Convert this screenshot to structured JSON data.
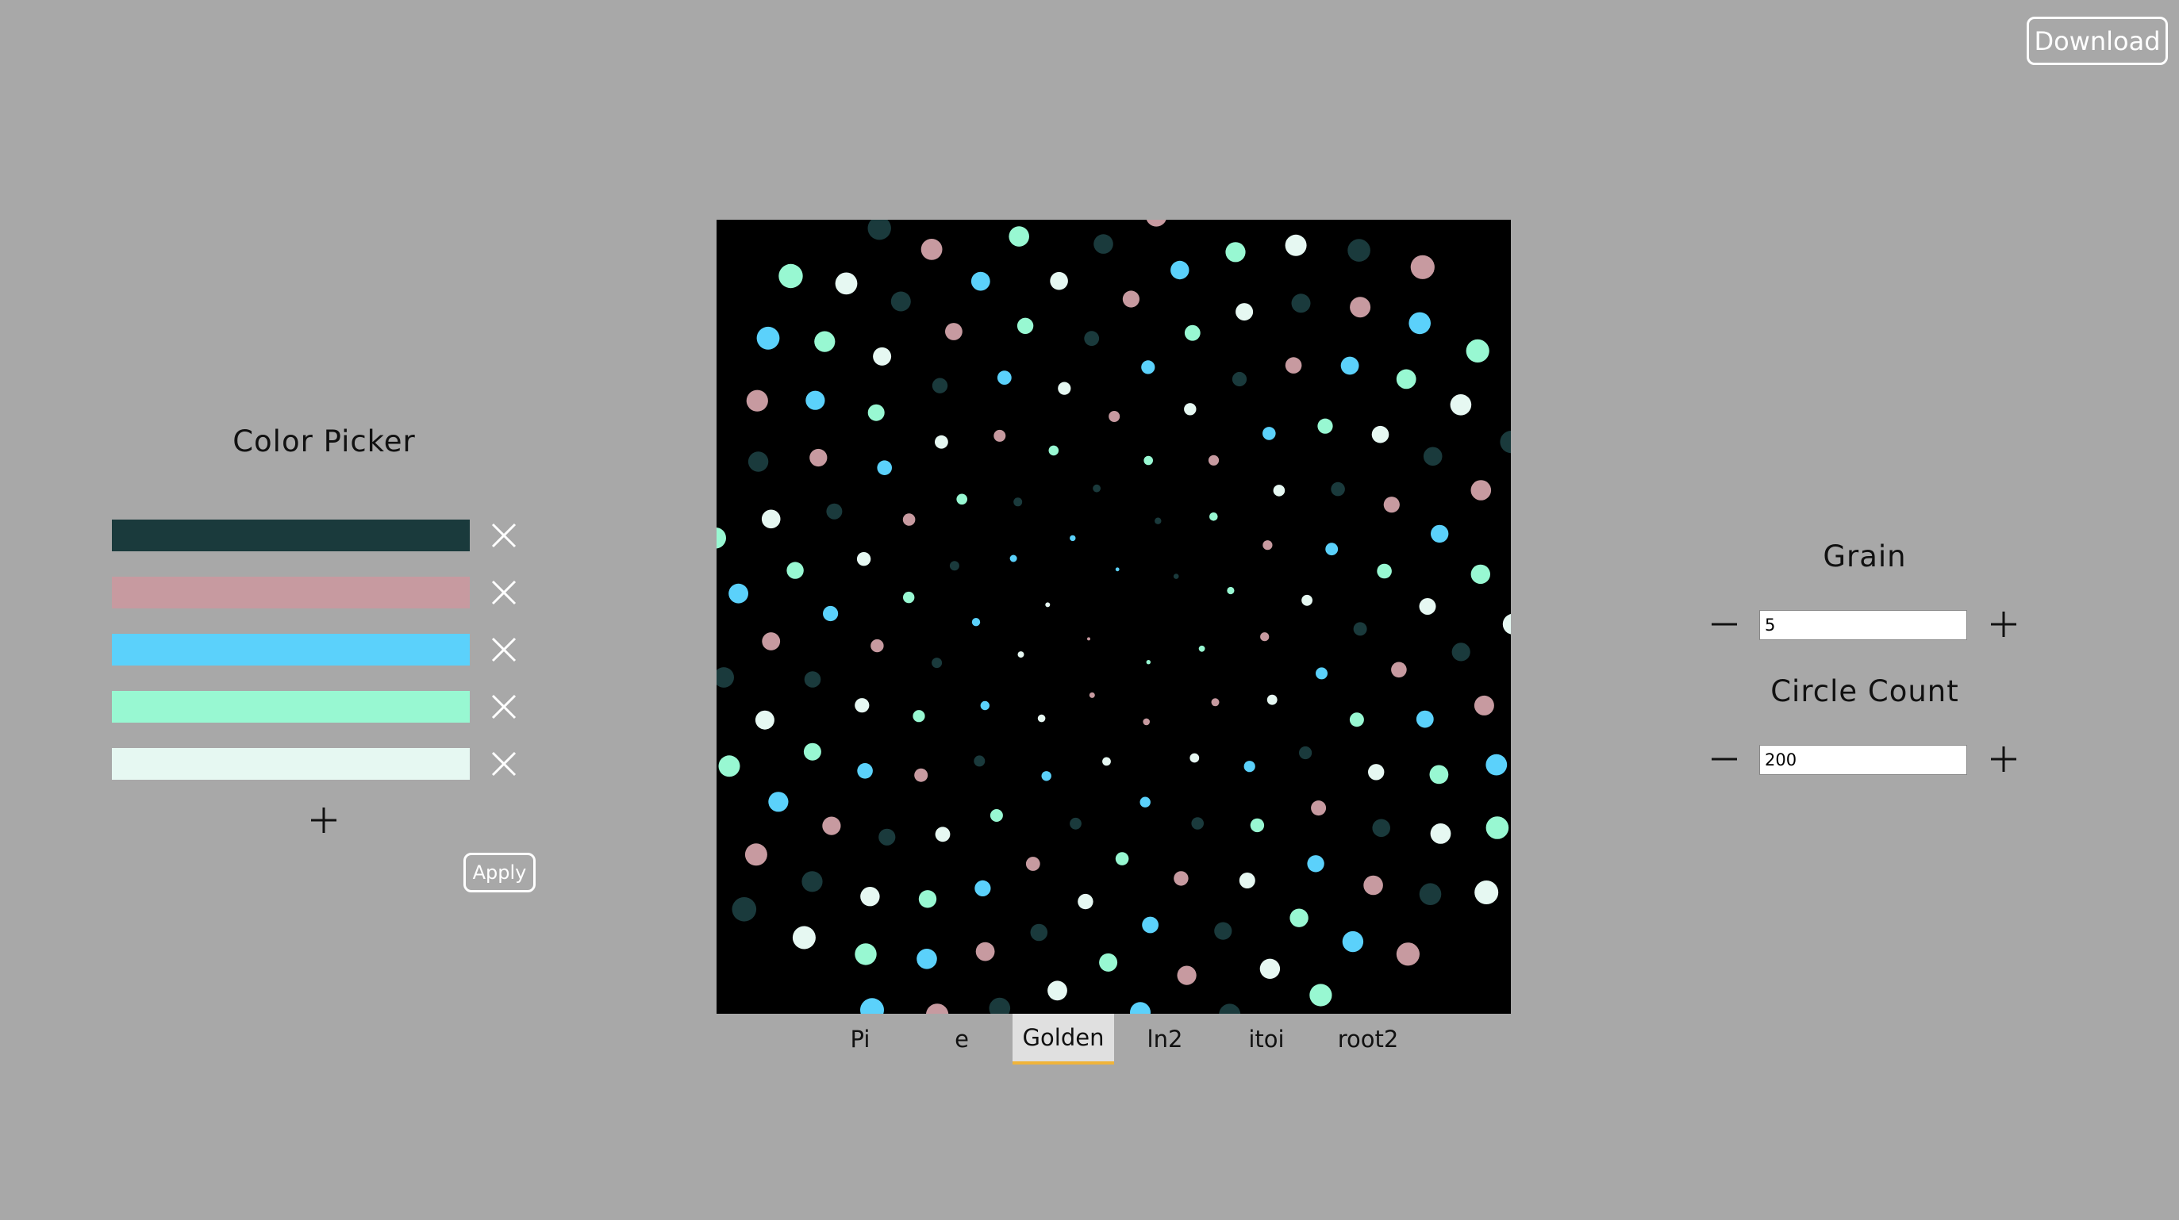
{
  "header": {
    "download_label": "Download"
  },
  "color_picker": {
    "title": "Color Picker",
    "colors": [
      {
        "hex": "#1a3a3c"
      },
      {
        "hex": "#c79aa0"
      },
      {
        "hex": "#5bd1fb"
      },
      {
        "hex": "#98f8d2"
      },
      {
        "hex": "#e6f8f2"
      }
    ],
    "remove_icon": "close-icon",
    "add_icon": "plus-icon",
    "apply_label": "Apply"
  },
  "canvas": {
    "background": "#000000",
    "palette": [
      "#1a3a3c",
      "#c79aa0",
      "#5bd1fb",
      "#98f8d2",
      "#e6f8f2"
    ]
  },
  "tabs": {
    "items": [
      {
        "label": "Pi"
      },
      {
        "label": "e"
      },
      {
        "label": "Golden"
      },
      {
        "label": "ln2"
      },
      {
        "label": "itoi"
      },
      {
        "label": "root2"
      }
    ],
    "active_index": 2,
    "active_accent": "#f0b43a"
  },
  "controls": {
    "grain": {
      "title": "Grain",
      "value": "5",
      "decrement_icon": "minus-icon",
      "increment_icon": "plus-icon"
    },
    "circle_count": {
      "title": "Circle Count",
      "value": "200",
      "decrement_icon": "minus-icon",
      "increment_icon": "plus-icon"
    }
  }
}
